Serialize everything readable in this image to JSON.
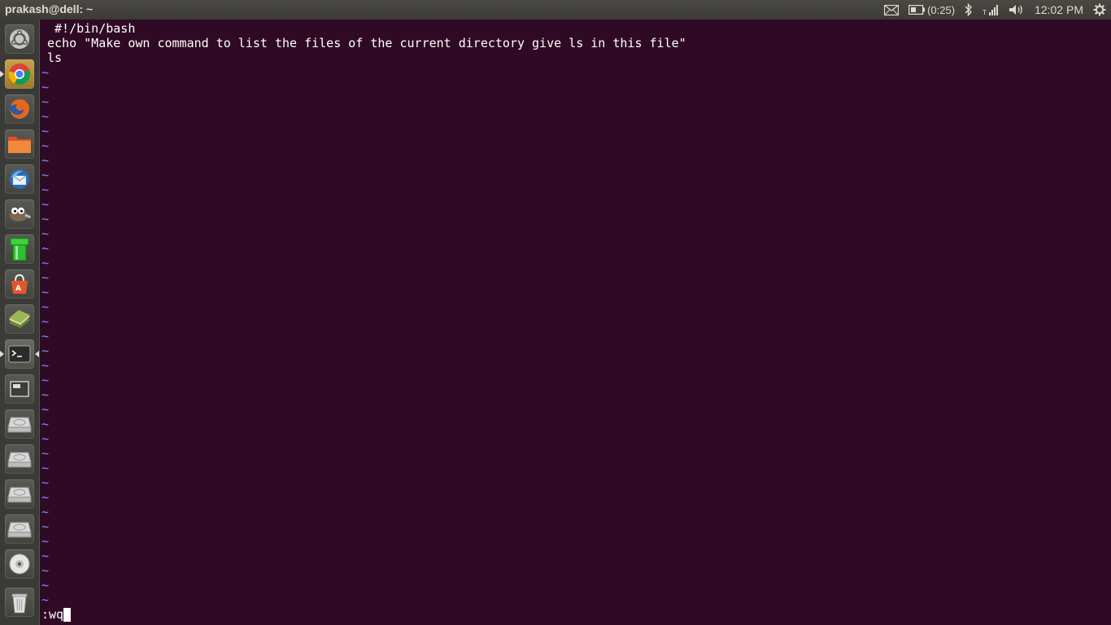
{
  "topbar": {
    "title": "prakash@dell: ~",
    "battery_label": "(0:25)",
    "clock": "12:02 PM"
  },
  "launcher": {
    "items": [
      {
        "name": "dash-home",
        "icon": "ubuntu-logo-icon"
      },
      {
        "name": "chrome",
        "icon": "chrome-icon"
      },
      {
        "name": "firefox",
        "icon": "firefox-icon"
      },
      {
        "name": "files",
        "icon": "folder-icon"
      },
      {
        "name": "thunderbird",
        "icon": "thunderbird-icon"
      },
      {
        "name": "gimp",
        "icon": "gimp-icon"
      },
      {
        "name": "green-pipe-app",
        "icon": "pipe-icon"
      },
      {
        "name": "software-center",
        "icon": "shopping-bag-icon"
      },
      {
        "name": "editor-book",
        "icon": "book-icon"
      },
      {
        "name": "terminal",
        "icon": "terminal-icon"
      },
      {
        "name": "workspace-switcher",
        "icon": "workspace-icon"
      },
      {
        "name": "drive-1",
        "icon": "hard-drive-icon"
      },
      {
        "name": "drive-2",
        "icon": "hard-drive-icon"
      },
      {
        "name": "drive-3",
        "icon": "hard-drive-icon"
      },
      {
        "name": "drive-4",
        "icon": "hard-drive-icon"
      },
      {
        "name": "optical-drive",
        "icon": "disc-icon"
      },
      {
        "name": "trash",
        "icon": "trash-icon"
      }
    ]
  },
  "editor": {
    "lines": [
      " #!/bin/bash",
      "echo \"Make own command to list the files of the current directory give ls in this file\"",
      "ls"
    ],
    "empty_marker": "~",
    "command_line": ":wq"
  },
  "colors": {
    "terminal_bg": "#300a24",
    "tilde": "#8a8aff",
    "panel": "#3c3b37"
  }
}
